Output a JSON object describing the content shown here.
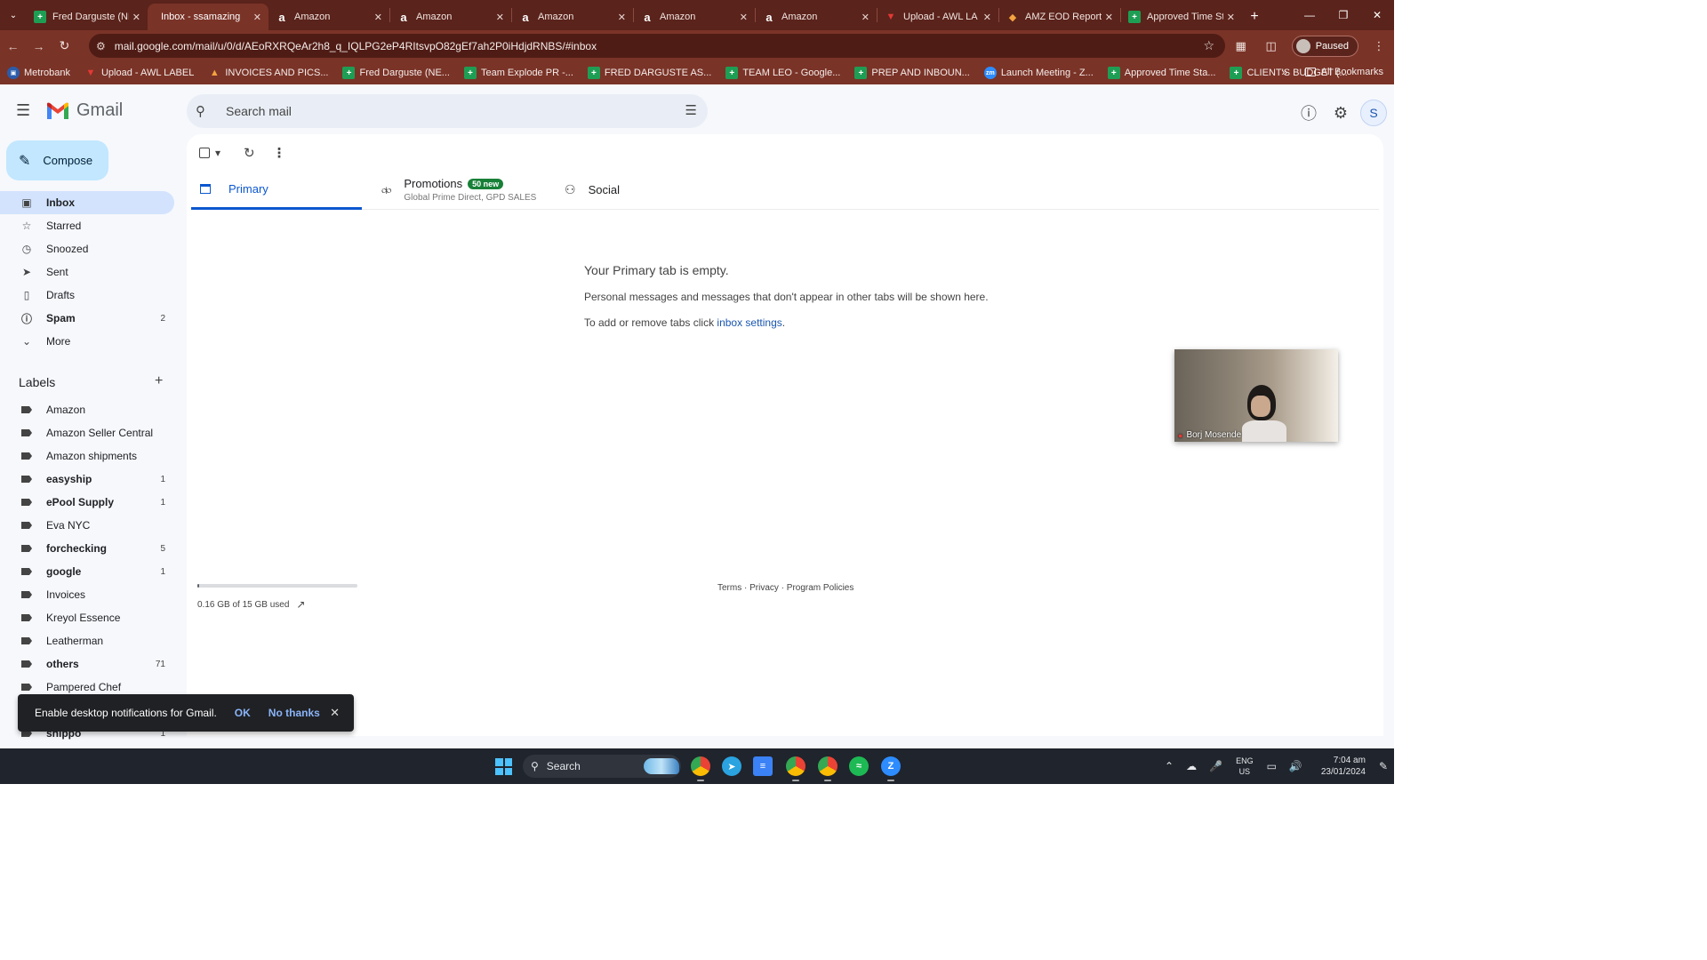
{
  "browser": {
    "tabs": [
      {
        "title": "Fred Darguste (NE",
        "icon": "sheets",
        "active": false
      },
      {
        "title": "Inbox - ssamazing",
        "icon": "gmail",
        "active": true
      },
      {
        "title": "Amazon",
        "icon": "amazon",
        "active": false
      },
      {
        "title": "Amazon",
        "icon": "amazon",
        "active": false
      },
      {
        "title": "Amazon",
        "icon": "amazon",
        "active": false
      },
      {
        "title": "Amazon",
        "icon": "amazon",
        "active": false
      },
      {
        "title": "Amazon",
        "icon": "amazon",
        "active": false
      },
      {
        "title": "Upload - AWL LA",
        "icon": "awl",
        "active": false
      },
      {
        "title": "AMZ EOD Report",
        "icon": "amz",
        "active": false
      },
      {
        "title": "Approved Time St",
        "icon": "sheets",
        "active": false
      }
    ],
    "url": "mail.google.com/mail/u/0/d/AEoRXRQeAr2h8_q_IQLPG2eP4RItsvpO82gEf7ah2P0iHdjdRNBS/#inbox",
    "profile_status": "Paused",
    "bookmarks": [
      {
        "label": "Metrobank",
        "icon": "metrobank"
      },
      {
        "label": "Upload - AWL LABEL",
        "icon": "awl"
      },
      {
        "label": "INVOICES AND PICS...",
        "icon": "drive"
      },
      {
        "label": "Fred Darguste (NE...",
        "icon": "sheets"
      },
      {
        "label": "Team Explode PR -...",
        "icon": "sheets"
      },
      {
        "label": "FRED DARGUSTE AS...",
        "icon": "sheets"
      },
      {
        "label": "TEAM LEO - Google...",
        "icon": "sheets"
      },
      {
        "label": "PREP AND INBOUN...",
        "icon": "sheets"
      },
      {
        "label": "Launch Meeting - Z...",
        "icon": "zoom"
      },
      {
        "label": "Approved Time Sta...",
        "icon": "sheets"
      },
      {
        "label": "CLIENT'S BUDGET (...",
        "icon": "sheets"
      }
    ],
    "all_bookmarks": "All Bookmarks"
  },
  "gmail": {
    "brand": "Gmail",
    "search_placeholder": "Search mail",
    "account_initial": "S",
    "compose": "Compose",
    "nav": [
      {
        "label": "Inbox",
        "icon": "inbox-icon",
        "count": "",
        "active": true,
        "bold": true
      },
      {
        "label": "Starred",
        "icon": "star-icon",
        "count": "",
        "active": false,
        "bold": false
      },
      {
        "label": "Snoozed",
        "icon": "clock-icon",
        "count": "",
        "active": false,
        "bold": false
      },
      {
        "label": "Sent",
        "icon": "send-icon",
        "count": "",
        "active": false,
        "bold": false
      },
      {
        "label": "Drafts",
        "icon": "draft-icon",
        "count": "",
        "active": false,
        "bold": false
      },
      {
        "label": "Spam",
        "icon": "spam-icon",
        "count": "2",
        "active": false,
        "bold": true
      },
      {
        "label": "More",
        "icon": "chevron-down-icon",
        "count": "",
        "active": false,
        "bold": false
      }
    ],
    "labels_heading": "Labels",
    "labels": [
      {
        "label": "Amazon",
        "count": "",
        "bold": false
      },
      {
        "label": "Amazon Seller Central",
        "count": "",
        "bold": false
      },
      {
        "label": "Amazon shipments",
        "count": "",
        "bold": false
      },
      {
        "label": "easyship",
        "count": "1",
        "bold": true
      },
      {
        "label": "ePool Supply",
        "count": "1",
        "bold": true
      },
      {
        "label": "Eva NYC",
        "count": "",
        "bold": false
      },
      {
        "label": "forchecking",
        "count": "5",
        "bold": true
      },
      {
        "label": "google",
        "count": "1",
        "bold": true
      },
      {
        "label": "Invoices",
        "count": "",
        "bold": false
      },
      {
        "label": "Kreyol Essence",
        "count": "",
        "bold": false
      },
      {
        "label": "Leatherman",
        "count": "",
        "bold": false
      },
      {
        "label": "others",
        "count": "71",
        "bold": true
      },
      {
        "label": "Pampered Chef",
        "count": "",
        "bold": false
      },
      {
        "label": "",
        "count": "",
        "bold": false
      },
      {
        "label": "shippo",
        "count": "1",
        "bold": true
      }
    ],
    "tabs": {
      "primary": "Primary",
      "promotions": "Promotions",
      "promotions_badge": "50 new",
      "promotions_sub": "Global Prime Direct, GPD SALES",
      "social": "Social"
    },
    "empty": {
      "title": "Your Primary tab is empty.",
      "description": "Personal messages and messages that don't appear in other tabs will be shown here.",
      "tabs_prefix": "To add or remove tabs click ",
      "tabs_link": "inbox settings",
      "tabs_suffix": "."
    },
    "storage": {
      "text": "0.16 GB of 15 GB used",
      "fraction": 0.011
    },
    "footer": "Terms · Privacy · Program Policies",
    "video_call": {
      "participant": "Borj Mosende"
    },
    "snackbar": {
      "message": "Enable desktop notifications for Gmail.",
      "ok": "OK",
      "no_thanks": "No thanks"
    }
  },
  "taskbar": {
    "search": "Search",
    "lang_top": "ENG",
    "lang_bottom": "US",
    "time": "7:04 am",
    "date": "23/01/2024"
  }
}
